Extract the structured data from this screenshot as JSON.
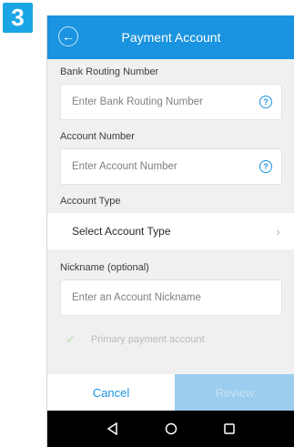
{
  "step_number": "3",
  "header": {
    "title": "Payment Account",
    "back_icon": "back-arrow-icon"
  },
  "form": {
    "routing_label": "Bank Routing Number",
    "routing_placeholder": "Enter Bank Routing Number",
    "account_label": "Account Number",
    "account_placeholder": "Enter Account Number",
    "type_label": "Account Type",
    "type_value": "Select Account Type",
    "nickname_label": "Nickname (optional)",
    "nickname_placeholder": "Enter an Account Nickname",
    "primary_label": "Primary payment account",
    "help_glyph": "?"
  },
  "buttons": {
    "cancel": "Cancel",
    "review": "Review"
  },
  "colors": {
    "accent": "#1a93e0",
    "badge": "#1aa6e6",
    "review_disabled": "#9ccdee",
    "background": "#f0f0f0"
  }
}
